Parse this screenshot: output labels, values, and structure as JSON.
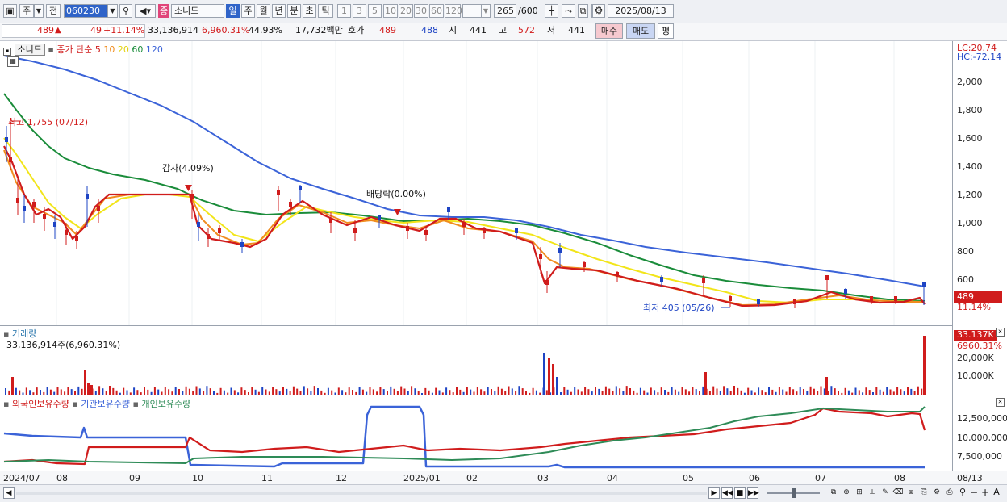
{
  "toolbar": {
    "period_week": "주",
    "prev_label": "전",
    "stock_code": "060230",
    "category_label": "종",
    "stock_name": "소니드",
    "period_tabs": [
      "일",
      "주",
      "월",
      "년",
      "분",
      "초",
      "틱"
    ],
    "interval_buttons": [
      "1",
      "3",
      "5",
      "10",
      "20",
      "30",
      "60",
      "120"
    ],
    "count_value": "265",
    "count_total": "/600",
    "date_value": "2025/08/13"
  },
  "info": {
    "price": "489",
    "price_arrow": "▲",
    "change": "49",
    "change_pct": "+11.14%",
    "volume": "33,136,914",
    "volume_pct": "6,960.31%",
    "turnover": "44.93%",
    "amount": "17,732백만",
    "quote_label": "호가",
    "ask": "489",
    "bid": "488",
    "open_label": "시",
    "open": "441",
    "high_label": "고",
    "high": "572",
    "low_label": "저",
    "low": "441",
    "buy_button": "매수",
    "sell_button": "매도",
    "eval_button": "평"
  },
  "price_panel": {
    "name_tag": "소니드",
    "ma_legend_prefix": "종가 단순",
    "ma_periods": [
      "5",
      "10",
      "20",
      "60",
      "120"
    ],
    "ma_colors": [
      "#d01c1c",
      "#f08c1e",
      "#f2e51a",
      "#1a8c3a",
      "#3b63d8"
    ],
    "lc_label": "LC:20.74",
    "hc_label": "HC:-72.14",
    "yticks": [
      "2,000",
      "1,800",
      "1,600",
      "1,400",
      "1,200",
      "1,000",
      "800",
      "600"
    ],
    "current_price_tag": "489",
    "current_change_tag": "11.14%",
    "high_annotation": "최고 1,755 (07/12)",
    "low_annotation": "최저 405 (05/26)",
    "event1": "감자(4.09%)",
    "event2": "배당락(0.00%)"
  },
  "volume_panel": {
    "title": "거래량",
    "value_text": "33,136,914주(6,960.31%)",
    "tag_value": "33.137K",
    "tag_pct": "6960.31%",
    "yticks": [
      "20,000K",
      "10,000K"
    ]
  },
  "holding_panel": {
    "legend_foreign": "외국인보유수량",
    "legend_inst": "기관보유수량",
    "legend_indiv": "개인보유수량",
    "colors": {
      "foreign": "#d01c1c",
      "inst": "#3b63d8",
      "indiv": "#2e8b57"
    },
    "yticks": [
      "12,500,000",
      "10,000,000",
      "7,500,000"
    ]
  },
  "x_axis": {
    "labels": [
      "2024/07",
      "08",
      "09",
      "10",
      "11",
      "12",
      "2025/01",
      "02",
      "03",
      "04",
      "05",
      "06",
      "07",
      "08"
    ],
    "right_label": "08/13"
  }
}
